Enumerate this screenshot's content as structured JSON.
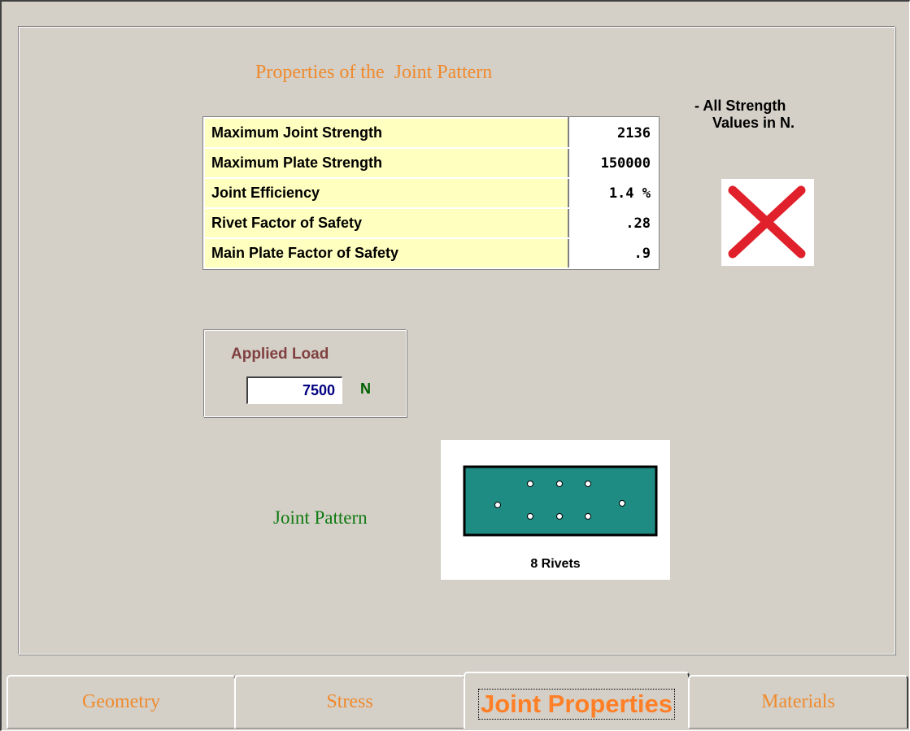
{
  "properties": {
    "title": "Properties of the  Joint Pattern",
    "rows": [
      {
        "label": "Maximum Joint Strength",
        "value": "2136"
      },
      {
        "label": "Maximum Plate Strength",
        "value": "150000"
      },
      {
        "label": "Joint Efficiency",
        "value": "1.4 %"
      },
      {
        "label": "Rivet Factor of Safety",
        "value": ".28"
      },
      {
        "label": "Main Plate Factor of Safety",
        "value": ".9"
      }
    ]
  },
  "note": {
    "line1": "- All Strength",
    "line2": "Values in N."
  },
  "status_icon": "red-x-fail-icon",
  "applied_load": {
    "label": "Applied Load",
    "value": "7500",
    "unit": "N"
  },
  "joint_pattern": {
    "label": "Joint Pattern",
    "rivet_count_label": "8 Rivets",
    "plate_color": "#1f8c84"
  },
  "tabs": [
    {
      "label": "Geometry",
      "active": false
    },
    {
      "label": "Stress",
      "active": false
    },
    {
      "label": "Joint Properties",
      "active": true
    },
    {
      "label": "Materials",
      "active": false
    }
  ],
  "colors": {
    "title_orange": "#f08a2c",
    "row_label_bg": "#ffffc0",
    "fail_red": "#e0202a",
    "pattern_label_green": "#107a10"
  }
}
